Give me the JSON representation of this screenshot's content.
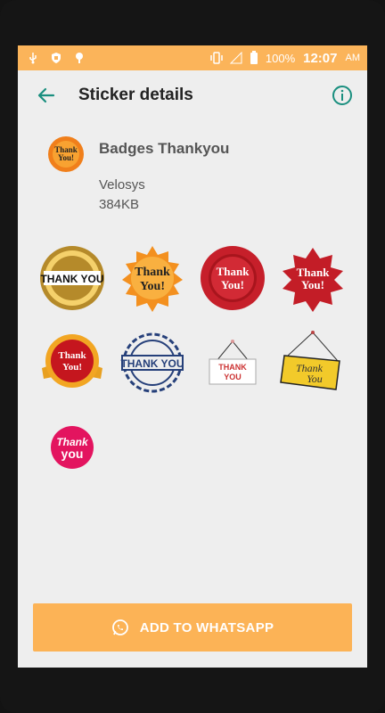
{
  "status_bar": {
    "battery_percent": "100%",
    "time": "12:07",
    "time_suffix": "AM"
  },
  "toolbar": {
    "title": "Sticker details",
    "back_icon": "arrow-left",
    "info_icon": "info-circle"
  },
  "pack": {
    "name": "Badges Thankyou",
    "publisher": "Velosys",
    "size": "384KB"
  },
  "stickers": [
    {
      "line1": "THANK YOU",
      "style": "gold-medal"
    },
    {
      "line1": "Thank",
      "line2": "You!",
      "style": "orange-burst"
    },
    {
      "line1": "Thank",
      "line2": "You!",
      "style": "red-rosette"
    },
    {
      "line1": "Thank",
      "line2": "You!",
      "style": "red-burst"
    },
    {
      "line1": "Thank",
      "line2": "You!",
      "style": "gold-ribbon"
    },
    {
      "line1": "THANK YOU",
      "style": "blue-stamp"
    },
    {
      "line1": "THANK",
      "line2": "YOU",
      "style": "white-sign"
    },
    {
      "line1": "Thank",
      "line2": "You",
      "style": "yellow-sign"
    },
    {
      "line1": "Thank",
      "line2": "you",
      "style": "pink-circle"
    }
  ],
  "colors": {
    "accent": "#fbb45a",
    "primary_icon": "#1a8f7f",
    "button": "#fcb356"
  },
  "button": {
    "label": "ADD TO WHATSAPP",
    "icon": "whatsapp-icon"
  }
}
